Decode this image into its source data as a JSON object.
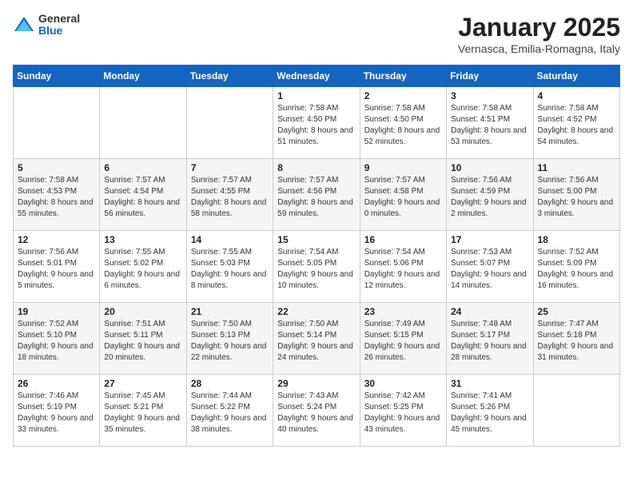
{
  "logo": {
    "general": "General",
    "blue": "Blue"
  },
  "title": "January 2025",
  "subtitle": "Vernasca, Emilia-Romagna, Italy",
  "weekdays": [
    "Sunday",
    "Monday",
    "Tuesday",
    "Wednesday",
    "Thursday",
    "Friday",
    "Saturday"
  ],
  "weeks": [
    [
      {
        "day": "",
        "info": ""
      },
      {
        "day": "",
        "info": ""
      },
      {
        "day": "",
        "info": ""
      },
      {
        "day": "1",
        "info": "Sunrise: 7:58 AM\nSunset: 4:50 PM\nDaylight: 8 hours\nand 51 minutes."
      },
      {
        "day": "2",
        "info": "Sunrise: 7:58 AM\nSunset: 4:50 PM\nDaylight: 8 hours\nand 52 minutes."
      },
      {
        "day": "3",
        "info": "Sunrise: 7:58 AM\nSunset: 4:51 PM\nDaylight: 8 hours\nand 53 minutes."
      },
      {
        "day": "4",
        "info": "Sunrise: 7:58 AM\nSunset: 4:52 PM\nDaylight: 8 hours\nand 54 minutes."
      }
    ],
    [
      {
        "day": "5",
        "info": "Sunrise: 7:58 AM\nSunset: 4:53 PM\nDaylight: 8 hours\nand 55 minutes."
      },
      {
        "day": "6",
        "info": "Sunrise: 7:57 AM\nSunset: 4:54 PM\nDaylight: 8 hours\nand 56 minutes."
      },
      {
        "day": "7",
        "info": "Sunrise: 7:57 AM\nSunset: 4:55 PM\nDaylight: 8 hours\nand 58 minutes."
      },
      {
        "day": "8",
        "info": "Sunrise: 7:57 AM\nSunset: 4:56 PM\nDaylight: 8 hours\nand 59 minutes."
      },
      {
        "day": "9",
        "info": "Sunrise: 7:57 AM\nSunset: 4:58 PM\nDaylight: 9 hours\nand 0 minutes."
      },
      {
        "day": "10",
        "info": "Sunrise: 7:56 AM\nSunset: 4:59 PM\nDaylight: 9 hours\nand 2 minutes."
      },
      {
        "day": "11",
        "info": "Sunrise: 7:56 AM\nSunset: 5:00 PM\nDaylight: 9 hours\nand 3 minutes."
      }
    ],
    [
      {
        "day": "12",
        "info": "Sunrise: 7:56 AM\nSunset: 5:01 PM\nDaylight: 9 hours\nand 5 minutes."
      },
      {
        "day": "13",
        "info": "Sunrise: 7:55 AM\nSunset: 5:02 PM\nDaylight: 9 hours\nand 6 minutes."
      },
      {
        "day": "14",
        "info": "Sunrise: 7:55 AM\nSunset: 5:03 PM\nDaylight: 9 hours\nand 8 minutes."
      },
      {
        "day": "15",
        "info": "Sunrise: 7:54 AM\nSunset: 5:05 PM\nDaylight: 9 hours\nand 10 minutes."
      },
      {
        "day": "16",
        "info": "Sunrise: 7:54 AM\nSunset: 5:06 PM\nDaylight: 9 hours\nand 12 minutes."
      },
      {
        "day": "17",
        "info": "Sunrise: 7:53 AM\nSunset: 5:07 PM\nDaylight: 9 hours\nand 14 minutes."
      },
      {
        "day": "18",
        "info": "Sunrise: 7:52 AM\nSunset: 5:09 PM\nDaylight: 9 hours\nand 16 minutes."
      }
    ],
    [
      {
        "day": "19",
        "info": "Sunrise: 7:52 AM\nSunset: 5:10 PM\nDaylight: 9 hours\nand 18 minutes."
      },
      {
        "day": "20",
        "info": "Sunrise: 7:51 AM\nSunset: 5:11 PM\nDaylight: 9 hours\nand 20 minutes."
      },
      {
        "day": "21",
        "info": "Sunrise: 7:50 AM\nSunset: 5:13 PM\nDaylight: 9 hours\nand 22 minutes."
      },
      {
        "day": "22",
        "info": "Sunrise: 7:50 AM\nSunset: 5:14 PM\nDaylight: 9 hours\nand 24 minutes."
      },
      {
        "day": "23",
        "info": "Sunrise: 7:49 AM\nSunset: 5:15 PM\nDaylight: 9 hours\nand 26 minutes."
      },
      {
        "day": "24",
        "info": "Sunrise: 7:48 AM\nSunset: 5:17 PM\nDaylight: 9 hours\nand 28 minutes."
      },
      {
        "day": "25",
        "info": "Sunrise: 7:47 AM\nSunset: 5:18 PM\nDaylight: 9 hours\nand 31 minutes."
      }
    ],
    [
      {
        "day": "26",
        "info": "Sunrise: 7:46 AM\nSunset: 5:19 PM\nDaylight: 9 hours\nand 33 minutes."
      },
      {
        "day": "27",
        "info": "Sunrise: 7:45 AM\nSunset: 5:21 PM\nDaylight: 9 hours\nand 35 minutes."
      },
      {
        "day": "28",
        "info": "Sunrise: 7:44 AM\nSunset: 5:22 PM\nDaylight: 9 hours\nand 38 minutes."
      },
      {
        "day": "29",
        "info": "Sunrise: 7:43 AM\nSunset: 5:24 PM\nDaylight: 9 hours\nand 40 minutes."
      },
      {
        "day": "30",
        "info": "Sunrise: 7:42 AM\nSunset: 5:25 PM\nDaylight: 9 hours\nand 43 minutes."
      },
      {
        "day": "31",
        "info": "Sunrise: 7:41 AM\nSunset: 5:26 PM\nDaylight: 9 hours\nand 45 minutes."
      },
      {
        "day": "",
        "info": ""
      }
    ]
  ]
}
